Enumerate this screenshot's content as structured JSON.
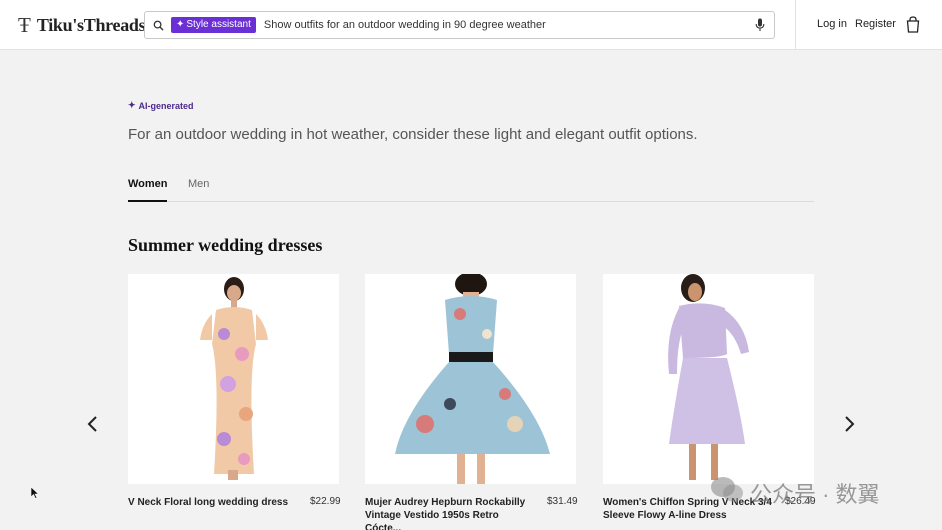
{
  "header": {
    "logo_mark": "Ŧ",
    "logo_text": "Tiku'sThreads",
    "assistant_chip": "Style assistant",
    "search_value": "Show outfits for an outdoor wedding in 90 degree weather",
    "login": "Log in",
    "register": "Register"
  },
  "ai_label": "AI-generated",
  "summary": "For an outdoor wedding in hot weather, consider these light and elegant outfit options.",
  "tabs": [
    {
      "label": "Women",
      "active": true
    },
    {
      "label": "Men",
      "active": false
    }
  ],
  "section_title": "Summer wedding dresses",
  "products": [
    {
      "name": "V Neck Floral long wedding dress",
      "price": "$22.99"
    },
    {
      "name": "Mujer Audrey Hepburn Rockabilly Vintage Vestido 1950s Retro Cócte...",
      "price": "$31.49"
    },
    {
      "name": "Women's Chiffon Spring V Neck 3/4 Sleeve Flowy A-line Dress",
      "price": "$26.49"
    }
  ],
  "watermark": "公众号 · 数翼"
}
